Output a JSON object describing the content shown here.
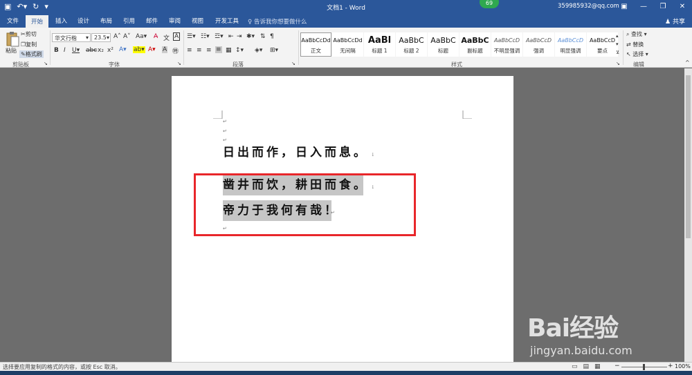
{
  "window": {
    "title": "文档1 - Word",
    "account": "359985932@qq.com",
    "notification_count": "69",
    "share_label": "共享"
  },
  "quick_access": {
    "save_icon": "save-icon",
    "undo_icon": "undo-icon",
    "redo_icon": "redo-icon",
    "customize_icon": "customize-icon"
  },
  "tabs": [
    {
      "label": "文件"
    },
    {
      "label": "开始"
    },
    {
      "label": "插入"
    },
    {
      "label": "设计"
    },
    {
      "label": "布局"
    },
    {
      "label": "引用"
    },
    {
      "label": "邮件"
    },
    {
      "label": "审阅"
    },
    {
      "label": "视图"
    },
    {
      "label": "开发工具"
    }
  ],
  "active_tab": "开始",
  "tell_me": "告诉我你想要做什么",
  "clipboard": {
    "paste": "粘贴",
    "cut": "剪切",
    "copy": "复制",
    "format_painter": "格式刷",
    "group_label": "剪贴板"
  },
  "font": {
    "name": "华文行楷",
    "size": "23.5",
    "group_label": "字体"
  },
  "paragraph": {
    "group_label": "段落"
  },
  "styles": {
    "group_label": "样式",
    "items": [
      {
        "sample": "AaBbCcDd",
        "name": "正文"
      },
      {
        "sample": "AaBbCcDd",
        "name": "无间隔"
      },
      {
        "sample": "AaBl",
        "name": "标题 1"
      },
      {
        "sample": "AaBbC",
        "name": "标题 2"
      },
      {
        "sample": "AaBbC",
        "name": "标题"
      },
      {
        "sample": "AaBbC",
        "name": "副标题"
      },
      {
        "sample": "AaBbCcD",
        "name": "不明显强调"
      },
      {
        "sample": "AaBbCcD",
        "name": "强调"
      },
      {
        "sample": "AaBbCcD",
        "name": "明显强调"
      },
      {
        "sample": "AaBbCcD",
        "name": "要点"
      }
    ]
  },
  "editing": {
    "find": "查找",
    "replace": "替换",
    "select": "选择",
    "group_label": "编辑"
  },
  "document": {
    "lines": [
      {
        "text": "日出而作，日入而息。",
        "selected": false
      },
      {
        "text": "凿井而饮，耕田而食。",
        "selected": true
      },
      {
        "text": "帝力于我何有哉！",
        "selected": true
      }
    ],
    "para_mark": "↵",
    "line_mark": "↓"
  },
  "status": {
    "message": "选择要应用复制的格式的内容，或按 Esc 取消。",
    "zoom": "100%"
  },
  "watermark": {
    "brand": "Bai经验",
    "url": "jingyan.baidu.com"
  },
  "colors": {
    "accent": "#2b579a",
    "highlight_box": "#e8262a",
    "selection": "#c6c6c6"
  }
}
